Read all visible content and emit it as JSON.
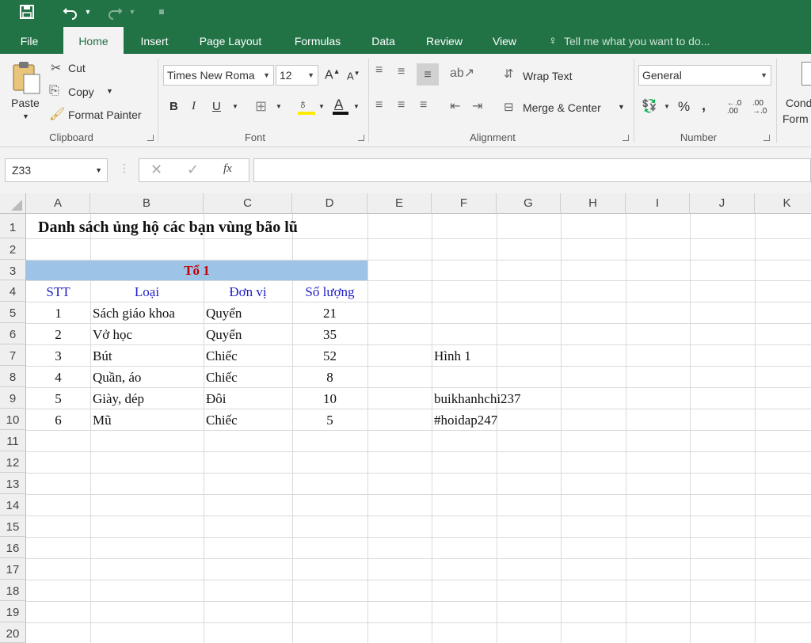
{
  "qat": {
    "save_icon": "save-icon",
    "undo_icon": "undo-icon",
    "redo_icon": "redo-icon",
    "customize_icon": "customize-icon"
  },
  "tabs": [
    "File",
    "Home",
    "Insert",
    "Page Layout",
    "Formulas",
    "Data",
    "Review",
    "View"
  ],
  "tell_me": "Tell me what you want to do...",
  "clipboard": {
    "paste": "Paste",
    "cut": "Cut",
    "copy": "Copy",
    "format_painter": "Format Painter",
    "label": "Clipboard"
  },
  "font": {
    "name": "Times New Roma",
    "size": "12",
    "label": "Font"
  },
  "alignment": {
    "wrap_text": "Wrap Text",
    "merge_center": "Merge & Center",
    "label": "Alignment"
  },
  "number": {
    "format": "General",
    "label": "Number"
  },
  "styles": {
    "cond_line1": "Cond",
    "cond_line2": "Form"
  },
  "formula_bar": {
    "name_box": "Z33",
    "value": ""
  },
  "columns": [
    "A",
    "B",
    "C",
    "D",
    "E",
    "F",
    "G",
    "H",
    "I",
    "J",
    "K"
  ],
  "rows": [
    "1",
    "2",
    "3",
    "4",
    "5",
    "6",
    "7",
    "8",
    "9",
    "10",
    "11",
    "12",
    "13",
    "14",
    "15",
    "16",
    "17",
    "18",
    "19",
    "20"
  ],
  "sheet": {
    "title": "Danh sách ủng hộ các bạn vùng bão lũ",
    "group": "Tổ 1",
    "headers": [
      "STT",
      "Loại",
      "Đơn vị",
      "Số lượng"
    ],
    "data": [
      [
        "1",
        "Sách giáo khoa",
        "Quyển",
        "21"
      ],
      [
        "2",
        "Vở học",
        "Quyển",
        "35"
      ],
      [
        "3",
        "Bút",
        "Chiếc",
        "52"
      ],
      [
        "4",
        "Quần, áo",
        "Chiếc",
        "8"
      ],
      [
        "5",
        "Giày, dép",
        "Đôi",
        "10"
      ],
      [
        "6",
        "Mũ",
        "Chiếc",
        "5"
      ]
    ],
    "f7": "Hình 1",
    "f9": "buikhanhchi237",
    "f10": "#hoidap247"
  },
  "colors": {
    "excel_green": "#217346",
    "group_fill": "#9dc3e6",
    "group_text": "#c00000",
    "header_text": "#2020c8"
  }
}
